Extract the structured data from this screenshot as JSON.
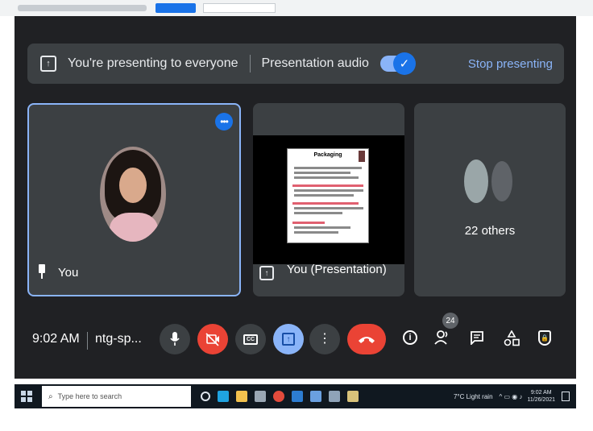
{
  "banner": {
    "presenting_text": "You're presenting to everyone",
    "audio_label": "Presentation audio",
    "audio_enabled": true,
    "stop_label": "Stop presenting"
  },
  "tiles": {
    "you_label": "You",
    "presentation_label": "You (Presentation)",
    "slide_title": "Packaging",
    "others_label": "22 others"
  },
  "controls": {
    "time": "9:02 AM",
    "meeting_code": "ntg-sp...",
    "participant_count": "24"
  },
  "taskbar": {
    "search_placeholder": "Type here to search",
    "weather": "7°C  Light rain",
    "clock_time": "9:02 AM",
    "clock_date": "11/26/2021"
  },
  "colors": {
    "meet_bg": "#202124",
    "tile_bg": "#3c4043",
    "accent_blue": "#8ab4f8",
    "brand_blue": "#1a73e8",
    "end_call_red": "#ea4335"
  },
  "icons": [
    "present-icon",
    "check-icon",
    "more-options-icon",
    "pin-icon",
    "mic-icon",
    "camera-off-icon",
    "captions-icon",
    "present-now-icon",
    "more-vert-icon",
    "end-call-icon",
    "info-icon",
    "people-icon",
    "chat-icon",
    "activities-icon",
    "host-controls-icon",
    "windows-icon",
    "search-icon"
  ]
}
